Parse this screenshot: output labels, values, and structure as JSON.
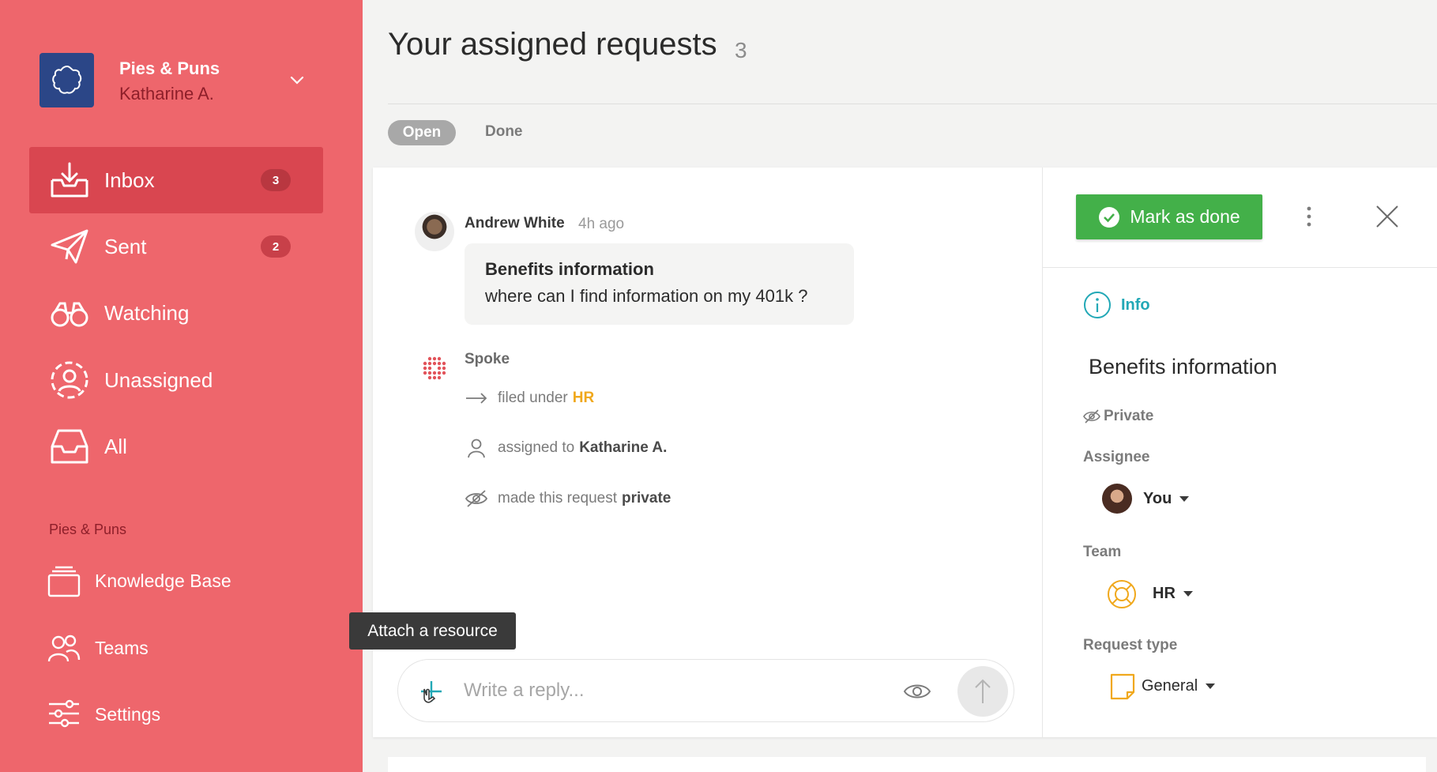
{
  "org": {
    "name": "Pies & Puns",
    "user": "Katharine A."
  },
  "nav": [
    {
      "label": "Inbox",
      "badge": "3",
      "active": true,
      "icon": "inbox-icon"
    },
    {
      "label": "Sent",
      "badge": "2",
      "active": false,
      "icon": "paper-plane-icon"
    },
    {
      "label": "Watching",
      "badge": null,
      "active": false,
      "icon": "binoculars-icon"
    },
    {
      "label": "Unassigned",
      "badge": null,
      "active": false,
      "icon": "unassigned-user-icon"
    },
    {
      "label": "All",
      "badge": null,
      "active": false,
      "icon": "tray-icon"
    }
  ],
  "section": {
    "title": "Pies & Puns",
    "items": [
      {
        "label": "Knowledge Base",
        "icon": "stack-icon"
      },
      {
        "label": "Teams",
        "icon": "people-icon"
      },
      {
        "label": "Settings",
        "icon": "sliders-icon"
      }
    ]
  },
  "header": {
    "title": "Your assigned requests",
    "count": "3"
  },
  "tabs": {
    "open": "Open",
    "done": "Done"
  },
  "message": {
    "author": "Andrew White",
    "time": "4h ago",
    "title": "Benefits information",
    "body": "where can I find information on my 401k ?"
  },
  "activity": {
    "actor": "Spoke",
    "filed_prefix": "filed under",
    "filed_value": "HR",
    "assigned_prefix": "assigned to",
    "assigned_value": "Katharine A.",
    "private_prefix": "made this request",
    "private_value": "private"
  },
  "tooltip": "Attach a resource",
  "reply": {
    "placeholder": "Write a reply..."
  },
  "panel": {
    "mark_done_label": "Mark as done",
    "info_label": "Info",
    "title": "Benefits information",
    "privacy": "Private",
    "assignee_label": "Assignee",
    "assignee_value": "You",
    "team_label": "Team",
    "team_value": "HR",
    "request_type_label": "Request type",
    "request_type_value": "General"
  },
  "colors": {
    "sidebar": "#ee666c",
    "sidebar_active": "#d94650",
    "mark_done": "#43b049",
    "info_accent": "#22a8b6",
    "team_accent": "#f0a81c"
  }
}
